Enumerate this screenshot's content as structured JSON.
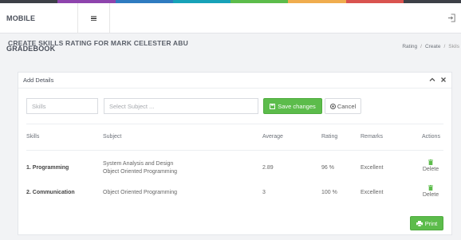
{
  "colors": {
    "stripe": [
      "#3d4047",
      "#8e44ad",
      "#2f7bc0",
      "#17a2b8",
      "#5cbc4b",
      "#f0ad4e",
      "#d9534f",
      "#3d4047"
    ],
    "success": "#5cbc4b"
  },
  "app": {
    "brand": "MOBILE GRADEBOOK",
    "menu_icon": "hamburger-icon",
    "logout_icon": "logout-icon"
  },
  "header": {
    "title": "CREATE SKILLS RATING FOR MARK CELESTER ABU",
    "breadcrumb": [
      "Rating",
      "Create",
      "Skils"
    ]
  },
  "card": {
    "title": "Add Details",
    "collapse_icon": "chevron-up-icon",
    "close_icon": "close-icon"
  },
  "form": {
    "skills_placeholder": "Skills",
    "subject_placeholder": "Select Subject ...",
    "save_label": "Save changes",
    "cancel_label": "Cancel"
  },
  "table": {
    "columns": [
      "Skills",
      "Subject",
      "Average",
      "Rating",
      "Remarks",
      "Actions"
    ],
    "rows": [
      {
        "skill": "1. Programming",
        "subjects": [
          "System Analysis and Design",
          "Object Oriented Programming"
        ],
        "average": "2.89",
        "rating": "96 %",
        "remarks": "Excellent",
        "action": "Delete"
      },
      {
        "skill": "2. Communication",
        "subjects": [
          "Object Oriented Programming"
        ],
        "average": "3",
        "rating": "100 %",
        "remarks": "Excellent",
        "action": "Delete"
      }
    ]
  },
  "print_label": "Print"
}
